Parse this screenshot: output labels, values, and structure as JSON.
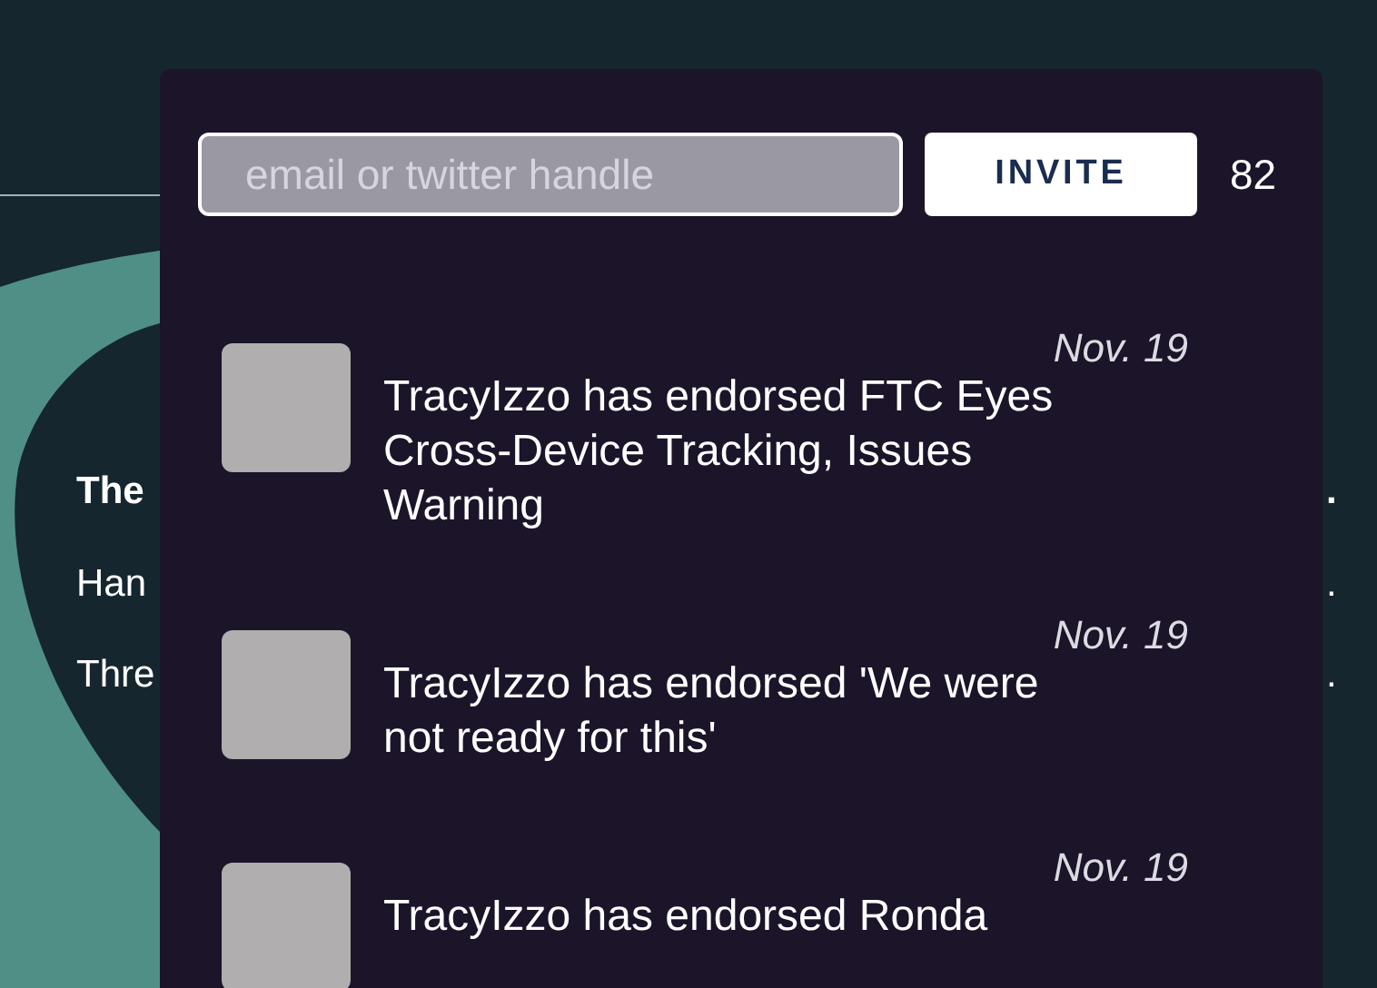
{
  "background": {
    "articles": [
      {
        "parts": [
          "The",
          "."
        ],
        "bold": true
      },
      {
        "parts": [
          "Han",
          "."
        ],
        "bold": false
      },
      {
        "parts": [
          "Thre",
          "."
        ],
        "bold": false
      }
    ]
  },
  "invite": {
    "placeholder": "email or twitter handle",
    "button": "INVITE",
    "count": "82"
  },
  "notifications": [
    {
      "date": "Nov. 19",
      "text": "TracyIzzo has endorsed FTC Eyes Cross-Device Tracking, Issues Warning"
    },
    {
      "date": "Nov. 19",
      "text": "TracyIzzo has endorsed 'We were not ready for this'"
    },
    {
      "date": "Nov. 19",
      "text": "TracyIzzo has endorsed Ronda"
    }
  ]
}
